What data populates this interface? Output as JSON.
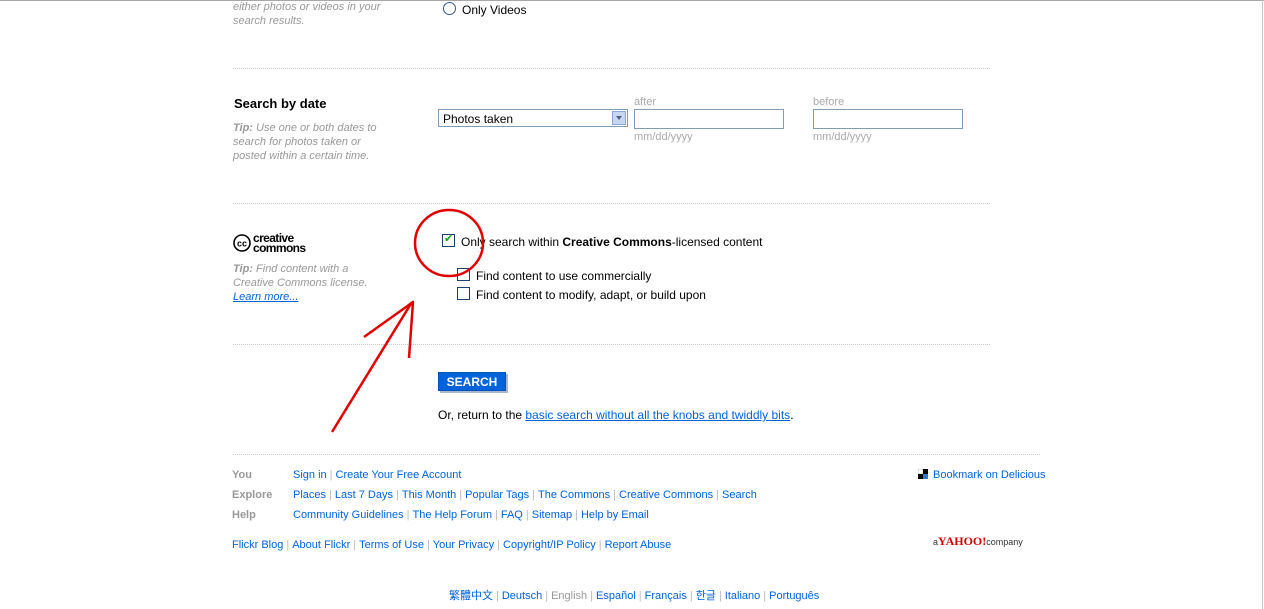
{
  "media_section": {
    "tip": "either photos or videos in your search results.",
    "radio_only_videos": "Only Videos"
  },
  "date_section": {
    "heading": "Search by date",
    "tip_label": "Tip:",
    "tip_text": "Use one or both dates to search for photos taken or posted within a certain time.",
    "select_value": "Photos taken",
    "after_label": "after",
    "before_label": "before",
    "date_format": "mm/dd/yyyy",
    "after_value": "",
    "before_value": ""
  },
  "cc_section": {
    "logo_text_top": "creative",
    "logo_text_bottom": "commons",
    "logo_cc": "cc",
    "tip_label": "Tip:",
    "tip_text": "Find content with a Creative Commons license.",
    "learn_more": "Learn more...",
    "only_cc_prefix": "Only search within ",
    "only_cc_bold": "Creative Commons",
    "only_cc_suffix": "-licensed content",
    "only_cc_checked": true,
    "commercial_label": "Find content to use commercially",
    "commercial_checked": false,
    "modify_label": "Find content to modify, adapt, or build upon",
    "modify_checked": false
  },
  "search": {
    "button_label": "SEARCH",
    "return_prefix": "Or, return to the ",
    "return_link": "basic search without all the knobs and twiddly bits",
    "return_suffix": "."
  },
  "footer": {
    "you_label": "You",
    "you_links": [
      "Sign in",
      "Create Your Free Account"
    ],
    "explore_label": "Explore",
    "explore_links": [
      "Places",
      "Last 7 Days",
      "This Month",
      "Popular Tags",
      "The Commons",
      "Creative Commons",
      "Search"
    ],
    "help_label": "Help",
    "help_links": [
      "Community Guidelines",
      "The Help Forum",
      "FAQ",
      "Sitemap",
      "Help by Email"
    ],
    "bottom_links": [
      "Flickr Blog",
      "About Flickr",
      "Terms of Use",
      "Your Privacy",
      "Copyright/IP Policy",
      "Report Abuse"
    ],
    "bookmark": "Bookmark on Delicious",
    "yahoo_prefix": "a",
    "yahoo_brand": "YAHOO!",
    "yahoo_suffix": "company"
  },
  "languages": {
    "items": [
      "繁體中文",
      "Deutsch",
      "English",
      "Español",
      "Français",
      "한글",
      "Italiano",
      "Português"
    ],
    "active": "English"
  },
  "colors": {
    "link": "#0063dc",
    "annotation": "#e00000",
    "button": "#0063dc"
  }
}
